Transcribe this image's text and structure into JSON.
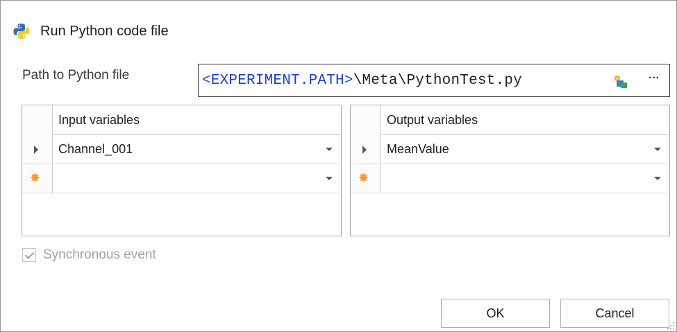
{
  "dialog": {
    "title": "Run Python code file",
    "title_icon": "python-icon"
  },
  "path": {
    "label": "Path to Python file",
    "variable": "<EXPERIMENT.PATH>",
    "rest": "\\Meta\\PythonTest.py",
    "browse_icon": "variable-picker-icon",
    "more_label": "···"
  },
  "input_grid": {
    "header": "Input variables",
    "rows": [
      {
        "indicator": "current-row-arrow",
        "value": "Channel_001"
      },
      {
        "indicator": "new-row-star",
        "value": ""
      }
    ]
  },
  "output_grid": {
    "header": "Output variables",
    "rows": [
      {
        "indicator": "current-row-arrow",
        "value": "MeanValue"
      },
      {
        "indicator": "new-row-star",
        "value": ""
      }
    ]
  },
  "sync": {
    "label": "Synchronous event",
    "checked": true,
    "enabled": false
  },
  "buttons": {
    "ok": "OK",
    "cancel": "Cancel"
  },
  "colors": {
    "variable_text": "#1a3fd6",
    "new_row_star": "#ff9922",
    "disabled_text": "#a0a0a0"
  }
}
